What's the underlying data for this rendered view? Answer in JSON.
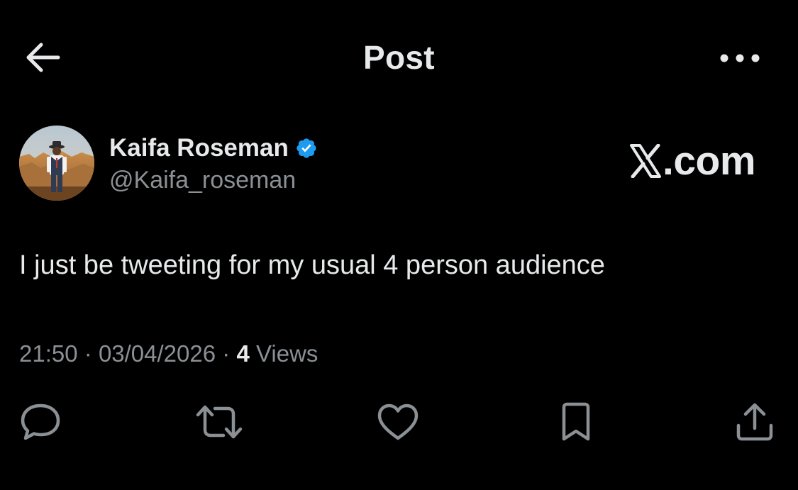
{
  "header": {
    "title": "Post",
    "back_icon": "arrow-left-icon",
    "more_icon": "more-horizontal-icon"
  },
  "post": {
    "author": {
      "name": "Kaifa Roseman",
      "handle": "@Kaifa_roseman",
      "verified": true,
      "verified_color": "#1d9bf0"
    },
    "watermark": ".com",
    "text": "I just be tweeting for my usual 4 person audience",
    "time": "21:50",
    "date": "03/04/2026",
    "separator": "·",
    "views_count": "4",
    "views_label": "Views"
  },
  "actions": [
    {
      "name": "reply",
      "icon": "reply-bubble-icon"
    },
    {
      "name": "repost",
      "icon": "repost-icon"
    },
    {
      "name": "like",
      "icon": "heart-icon"
    },
    {
      "name": "bookmark",
      "icon": "bookmark-icon"
    },
    {
      "name": "share",
      "icon": "share-upload-icon"
    }
  ],
  "colors": {
    "background": "#000000",
    "text_primary": "#e7e9ea",
    "text_secondary": "#8b9095",
    "icon": "#8b9095",
    "accent": "#1d9bf0"
  }
}
